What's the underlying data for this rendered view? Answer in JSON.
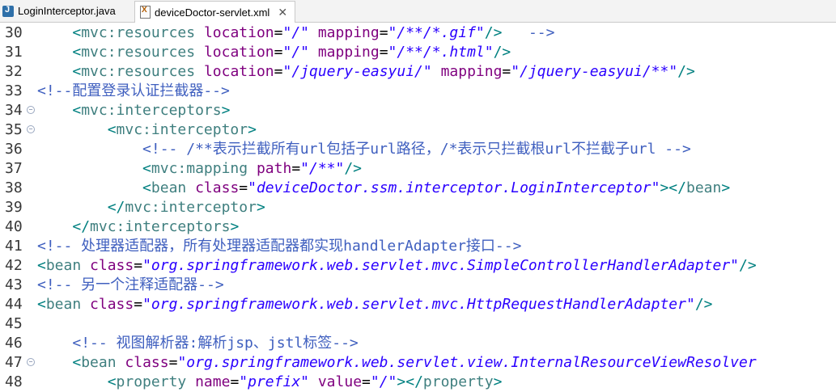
{
  "tabs": [
    {
      "label": "LoginInterceptor.java",
      "icon": "java-file-icon",
      "active": false
    },
    {
      "label": "deviceDoctor-servlet.xml",
      "icon": "xml-file-icon",
      "active": true
    }
  ],
  "close_glyph": "✕",
  "lines": [
    {
      "num": "30",
      "indent": "    ",
      "fold": false,
      "tokens": [
        {
          "t": "br",
          "v": "<"
        },
        {
          "t": "tag",
          "v": "mvc:resources"
        },
        {
          "t": "plain",
          "v": " "
        },
        {
          "t": "attr",
          "v": "location"
        },
        {
          "t": "plain",
          "v": "="
        },
        {
          "t": "val",
          "v": "\"/\""
        },
        {
          "t": "plain",
          "v": " "
        },
        {
          "t": "attr",
          "v": "mapping"
        },
        {
          "t": "plain",
          "v": "="
        },
        {
          "t": "val",
          "v": "\"/**/*.gif\""
        },
        {
          "t": "br",
          "v": "/>"
        },
        {
          "t": "cmt",
          "v": "   -->"
        }
      ]
    },
    {
      "num": "31",
      "indent": "    ",
      "fold": false,
      "tokens": [
        {
          "t": "br",
          "v": "<"
        },
        {
          "t": "tag",
          "v": "mvc:resources"
        },
        {
          "t": "plain",
          "v": " "
        },
        {
          "t": "attr",
          "v": "location"
        },
        {
          "t": "plain",
          "v": "="
        },
        {
          "t": "val",
          "v": "\"/\""
        },
        {
          "t": "plain",
          "v": " "
        },
        {
          "t": "attr",
          "v": "mapping"
        },
        {
          "t": "plain",
          "v": "="
        },
        {
          "t": "val",
          "v": "\"/**/*.html\""
        },
        {
          "t": "br",
          "v": "/>"
        }
      ]
    },
    {
      "num": "32",
      "indent": "    ",
      "fold": false,
      "tokens": [
        {
          "t": "br",
          "v": "<"
        },
        {
          "t": "tag",
          "v": "mvc:resources"
        },
        {
          "t": "plain",
          "v": " "
        },
        {
          "t": "attr",
          "v": "location"
        },
        {
          "t": "plain",
          "v": "="
        },
        {
          "t": "val",
          "v": "\"/jquery-easyui/\""
        },
        {
          "t": "plain",
          "v": " "
        },
        {
          "t": "attr",
          "v": "mapping"
        },
        {
          "t": "plain",
          "v": "="
        },
        {
          "t": "val",
          "v": "\"/jquery-easyui/**\""
        },
        {
          "t": "br",
          "v": "/>"
        }
      ]
    },
    {
      "num": "33",
      "indent": "",
      "fold": false,
      "tokens": [
        {
          "t": "cmt",
          "v": "<!--配置登录认证拦截器-->"
        }
      ]
    },
    {
      "num": "34",
      "indent": "    ",
      "fold": true,
      "tokens": [
        {
          "t": "br",
          "v": "<"
        },
        {
          "t": "tag",
          "v": "mvc:interceptors"
        },
        {
          "t": "br",
          "v": ">"
        }
      ]
    },
    {
      "num": "35",
      "indent": "        ",
      "fold": true,
      "tokens": [
        {
          "t": "br",
          "v": "<"
        },
        {
          "t": "tag",
          "v": "mvc:interceptor"
        },
        {
          "t": "br",
          "v": ">"
        }
      ]
    },
    {
      "num": "36",
      "indent": "            ",
      "fold": false,
      "tokens": [
        {
          "t": "cmt",
          "v": "<!-- /**表示拦截所有url包括子url路径，/*表示只拦截根url不拦截子url -->"
        }
      ]
    },
    {
      "num": "37",
      "indent": "            ",
      "fold": false,
      "tokens": [
        {
          "t": "br",
          "v": "<"
        },
        {
          "t": "tag",
          "v": "mvc:mapping"
        },
        {
          "t": "plain",
          "v": " "
        },
        {
          "t": "attr",
          "v": "path"
        },
        {
          "t": "plain",
          "v": "="
        },
        {
          "t": "val",
          "v": "\"/**\""
        },
        {
          "t": "br",
          "v": "/>"
        }
      ]
    },
    {
      "num": "38",
      "indent": "            ",
      "fold": false,
      "tokens": [
        {
          "t": "br",
          "v": "<"
        },
        {
          "t": "tag",
          "v": "bean"
        },
        {
          "t": "plain",
          "v": " "
        },
        {
          "t": "attr",
          "v": "class"
        },
        {
          "t": "plain",
          "v": "="
        },
        {
          "t": "val",
          "v": "\"deviceDoctor.ssm.interceptor.LoginInterceptor\""
        },
        {
          "t": "br",
          "v": "></"
        },
        {
          "t": "tag",
          "v": "bean"
        },
        {
          "t": "br",
          "v": ">"
        }
      ]
    },
    {
      "num": "39",
      "indent": "        ",
      "fold": false,
      "tokens": [
        {
          "t": "br",
          "v": "</"
        },
        {
          "t": "tag",
          "v": "mvc:interceptor"
        },
        {
          "t": "br",
          "v": ">"
        }
      ]
    },
    {
      "num": "40",
      "indent": "    ",
      "fold": false,
      "tokens": [
        {
          "t": "br",
          "v": "</"
        },
        {
          "t": "tag",
          "v": "mvc:interceptors"
        },
        {
          "t": "br",
          "v": ">"
        }
      ]
    },
    {
      "num": "41",
      "indent": "",
      "fold": false,
      "tokens": [
        {
          "t": "cmt",
          "v": "<!-- 处理器适配器，所有处理器适配器都实现handlerAdapter接口-->"
        }
      ]
    },
    {
      "num": "42",
      "indent": "",
      "fold": false,
      "tokens": [
        {
          "t": "br",
          "v": "<"
        },
        {
          "t": "tag",
          "v": "bean"
        },
        {
          "t": "plain",
          "v": " "
        },
        {
          "t": "attr",
          "v": "class"
        },
        {
          "t": "plain",
          "v": "="
        },
        {
          "t": "val",
          "v": "\"org.springframework.web.servlet.mvc.SimpleControllerHandlerAdapter\""
        },
        {
          "t": "br",
          "v": "/>"
        }
      ]
    },
    {
      "num": "43",
      "indent": "",
      "fold": false,
      "tokens": [
        {
          "t": "cmt",
          "v": "<!-- 另一个注释适配器-->"
        }
      ]
    },
    {
      "num": "44",
      "indent": "",
      "fold": false,
      "tokens": [
        {
          "t": "br",
          "v": "<"
        },
        {
          "t": "tag",
          "v": "bean"
        },
        {
          "t": "plain",
          "v": " "
        },
        {
          "t": "attr",
          "v": "class"
        },
        {
          "t": "plain",
          "v": "="
        },
        {
          "t": "val",
          "v": "\"org.springframework.web.servlet.mvc.HttpRequestHandlerAdapter\""
        },
        {
          "t": "br",
          "v": "/>"
        }
      ]
    },
    {
      "num": "45",
      "indent": "",
      "fold": false,
      "tokens": []
    },
    {
      "num": "46",
      "indent": "    ",
      "fold": false,
      "tokens": [
        {
          "t": "cmt",
          "v": "<!-- 视图解析器:解析jsp、jstl标签-->"
        }
      ]
    },
    {
      "num": "47",
      "indent": "    ",
      "fold": true,
      "tokens": [
        {
          "t": "br",
          "v": "<"
        },
        {
          "t": "tag",
          "v": "bean"
        },
        {
          "t": "plain",
          "v": " "
        },
        {
          "t": "attr",
          "v": "class"
        },
        {
          "t": "plain",
          "v": "="
        },
        {
          "t": "val",
          "v": "\"org.springframework.web.servlet.view.InternalResourceViewResolver"
        }
      ]
    },
    {
      "num": "48",
      "indent": "        ",
      "fold": false,
      "tokens": [
        {
          "t": "br",
          "v": "<"
        },
        {
          "t": "tag",
          "v": "property"
        },
        {
          "t": "plain",
          "v": " "
        },
        {
          "t": "attr",
          "v": "name"
        },
        {
          "t": "plain",
          "v": "="
        },
        {
          "t": "val",
          "v": "\"prefix\""
        },
        {
          "t": "plain",
          "v": " "
        },
        {
          "t": "attr",
          "v": "value"
        },
        {
          "t": "plain",
          "v": "="
        },
        {
          "t": "val",
          "v": "\"/\""
        },
        {
          "t": "br",
          "v": "></"
        },
        {
          "t": "tag",
          "v": "property"
        },
        {
          "t": "br",
          "v": ">"
        }
      ]
    }
  ]
}
